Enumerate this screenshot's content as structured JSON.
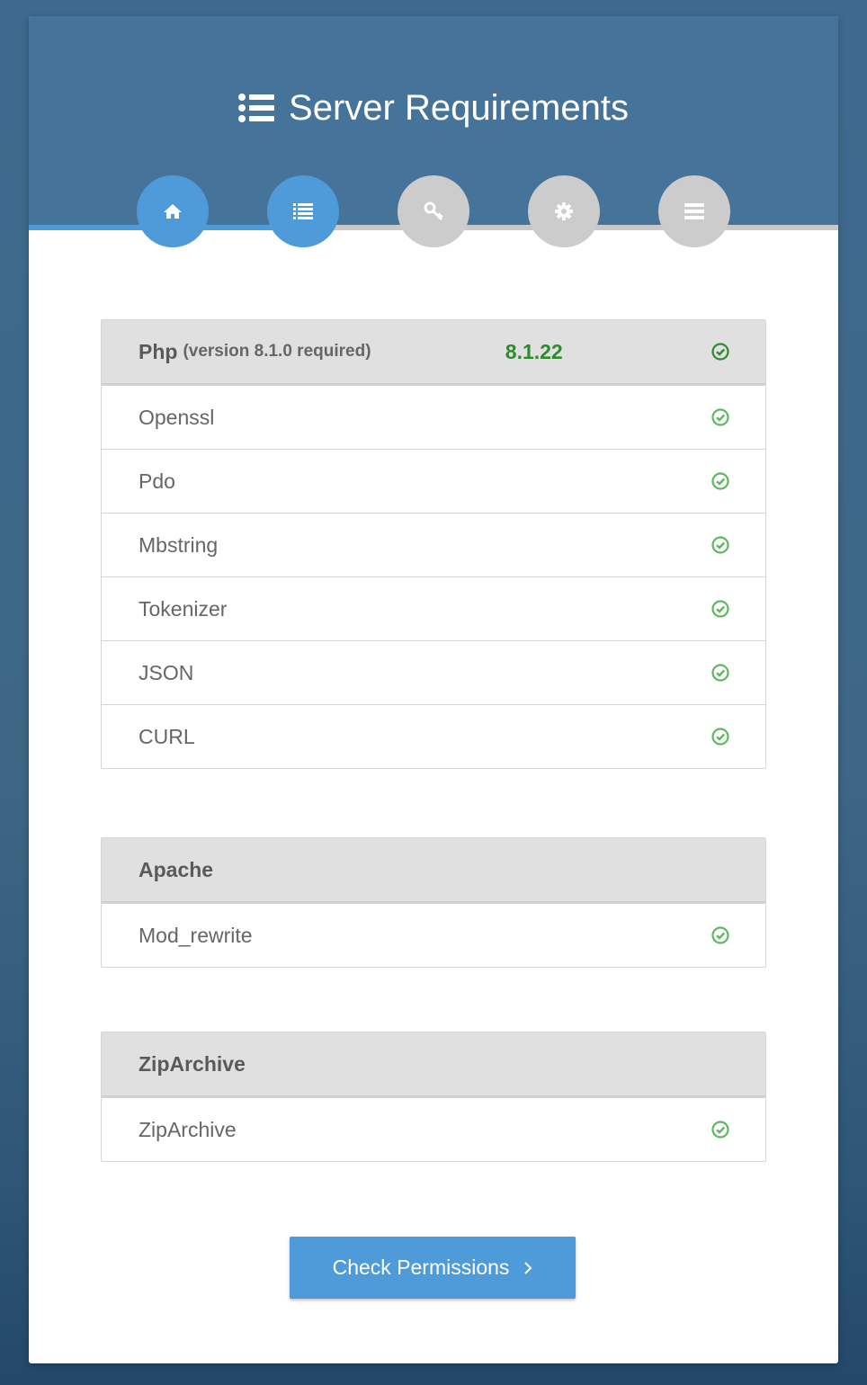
{
  "header": {
    "title": "Server Requirements",
    "title_icon": "list-icon"
  },
  "steps": [
    {
      "name": "home",
      "icon": "home-icon",
      "state": "completed"
    },
    {
      "name": "requirements",
      "icon": "list-icon",
      "state": "active"
    },
    {
      "name": "permissions",
      "icon": "key-icon",
      "state": "pending"
    },
    {
      "name": "environment",
      "icon": "gear-icon",
      "state": "pending"
    },
    {
      "name": "database",
      "icon": "server-icon",
      "state": "pending"
    }
  ],
  "progress_fraction": 0.34,
  "groups": [
    {
      "name": "Php",
      "sub": "(version 8.1.0 required)",
      "version": "8.1.22",
      "rows": [
        "Openssl",
        "Pdo",
        "Mbstring",
        "Tokenizer",
        "JSON",
        "CURL"
      ]
    },
    {
      "name": "Apache",
      "rows": [
        "Mod_rewrite"
      ]
    },
    {
      "name": "ZipArchive",
      "rows": [
        "ZipArchive"
      ]
    }
  ],
  "colors": {
    "accent": "#4f9ad8",
    "header_bg": "#46739a",
    "ok": "#5cb85c",
    "version_ok": "#2e8b2e"
  },
  "actions": {
    "next_label": "Check Permissions"
  }
}
